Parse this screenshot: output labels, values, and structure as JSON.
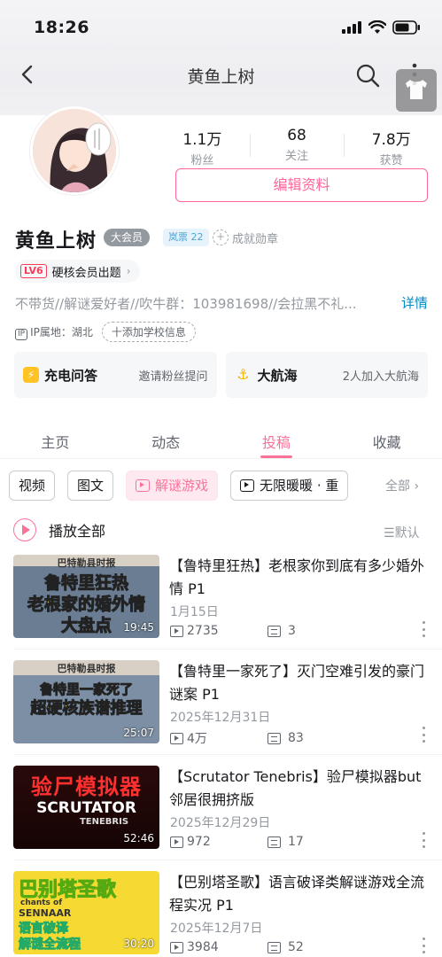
{
  "status": {
    "time": "18:26"
  },
  "nav": {
    "title": "黄鱼上树"
  },
  "profile": {
    "stats": [
      {
        "value": "1.1万",
        "label": "粉丝"
      },
      {
        "value": "68",
        "label": "关注"
      },
      {
        "value": "7.8万",
        "label": "获赞"
      }
    ],
    "edit_label": "编辑资料",
    "name": "黄鱼上树",
    "vip_label": "大会员",
    "ticket_label": "岚票 22",
    "medal_label": "成就勋章",
    "lv_tag": "LV6",
    "lv_text": "硬核会员出题",
    "bio": "不带货//解谜爱好者//吹牛群：103981698//会拉黑不礼...",
    "detail_label": "详情",
    "ip_label": "IP属地：湖北",
    "school_label": "十添加学校信息"
  },
  "cards": [
    {
      "title": "充电问答",
      "sub": "邀请粉丝提问"
    },
    {
      "title": "大航海",
      "sub": "2人加入大航海"
    }
  ],
  "tabs": [
    "主页",
    "动态",
    "投稿",
    "收藏"
  ],
  "filters": [
    "视频",
    "图文",
    "解谜游戏",
    "无限暖暖 · 重"
  ],
  "all_label": "全部",
  "playall_label": "播放全部",
  "sort_label": "默认",
  "videos": [
    {
      "title": "【鲁特里狂热】老根家你到底有多少婚外情 P1",
      "date": "1月15日",
      "plays": "2735",
      "danmaku": "3",
      "duration": "19:45",
      "thumb_head": "巴特勒县时报",
      "thumb_lines": [
        "鲁特里狂热",
        "老根家的婚外情",
        "大盘点"
      ]
    },
    {
      "title": "【鲁特里一家死了】灭门空难引发的豪门谜案 P1",
      "date": "2025年12月31日",
      "plays": "4万",
      "danmaku": "83",
      "duration": "25:07",
      "thumb_head": "巴特勒县时报",
      "thumb_lines": [
        "鲁特里一家死了",
        "超硬核族谱推理"
      ]
    },
    {
      "title": "【Scrutator Tenebris】验尸模拟器but 邻居很拥挤版",
      "date": "2025年12月29日",
      "plays": "972",
      "danmaku": "17",
      "duration": "52:46",
      "thumb_lines": [
        "验尸模拟器",
        "SCRUTATOR",
        "TENEBRIS"
      ]
    },
    {
      "title": "【巴别塔圣歌】语言破译类解谜游戏全流程实况 P1",
      "date": "2025年12月7日",
      "plays": "3984",
      "danmaku": "52",
      "duration": "30:20",
      "thumb_lines": [
        "巴别塔圣歌",
        "chants of",
        "SENNAAR",
        "语言破译",
        "解谜全流程"
      ]
    }
  ],
  "colors": {
    "accent": "#fb7299",
    "edit": "#ff6699",
    "link": "#008ac5"
  }
}
